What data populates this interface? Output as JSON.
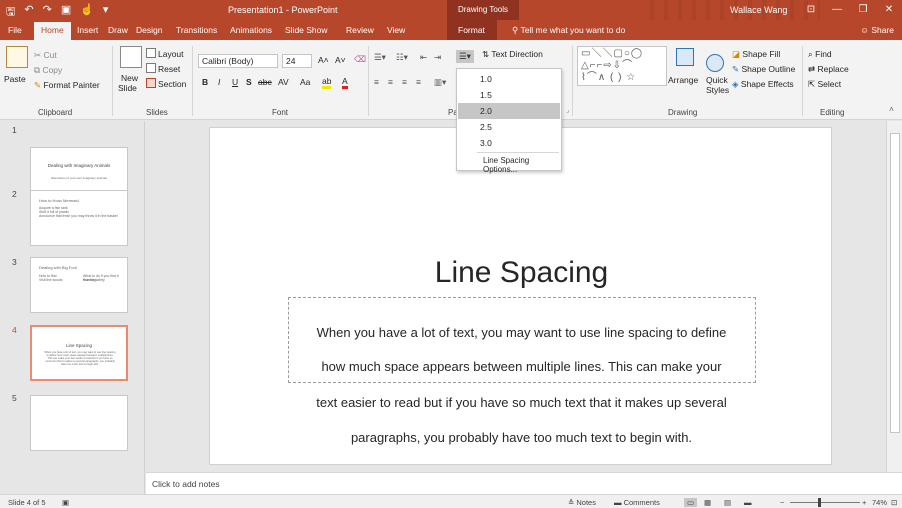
{
  "titlebar": {
    "title": "Presentation1 - PowerPoint",
    "context_label": "Drawing Tools",
    "user": "Wallace Wang",
    "qat": [
      "save-icon",
      "undo-icon",
      "redo-icon",
      "present-icon",
      "touch-icon",
      "customize-icon"
    ],
    "window_buttons": [
      "ribbon-display-icon",
      "minimize-icon",
      "restore-icon",
      "close-icon"
    ],
    "glyphs": {
      "save": "🖫",
      "undo": "↶",
      "redo": "↷",
      "present": "▣",
      "touch": "☝",
      "more": "▾",
      "ribbon": "⊡",
      "min": "—",
      "restore": "❐",
      "close": "✕"
    }
  },
  "tabs": {
    "items": [
      "File",
      "Home",
      "Insert",
      "Draw",
      "Design",
      "Transitions",
      "Animations",
      "Slide Show",
      "Review",
      "View",
      "Format"
    ],
    "active": "Home",
    "tell_me": "Tell me what you want to do",
    "share": "Share"
  },
  "ribbon": {
    "clipboard": {
      "paste": "Paste",
      "cut": "Cut",
      "copy": "Copy",
      "format_painter": "Format Painter",
      "label": "Clipboard"
    },
    "slides": {
      "new_slide": "New",
      "new_slide2": "Slide",
      "layout": "Layout",
      "reset": "Reset",
      "section": "Section",
      "label": "Slides"
    },
    "font": {
      "name": "Calibri (Body)",
      "size": "24",
      "label": "Font",
      "bold": "B",
      "italic": "I",
      "underline": "U",
      "shadow": "S",
      "strike": "abc",
      "spacing": "AV",
      "case": "Aa",
      "grow": "A˄",
      "shrink": "A˅"
    },
    "paragraph": {
      "label": "Pa",
      "text_direction": "Text Direction"
    },
    "drawing": {
      "arrange": "Arrange",
      "quick_styles": "Quick",
      "quick_styles2": "Styles",
      "shape_fill": "Shape Fill",
      "shape_outline": "Shape Outline",
      "shape_effects": "Shape Effects",
      "label": "Drawing",
      "shapes_row1": "▭＼＼▢○◯",
      "shapes_row2": "△⌐⌐⇨⇩⌒",
      "shapes_row3": "⌇⌒∧ ( ) ☆"
    },
    "editing": {
      "find": "Find",
      "replace": "Replace",
      "select": "Select",
      "label": "Editing"
    }
  },
  "line_spacing_menu": {
    "options": [
      "1.0",
      "1.5",
      "2.0",
      "2.5",
      "3.0"
    ],
    "selected": "2.0",
    "more": "Line Spacing Options..."
  },
  "thumbnails": [
    {
      "num": "1",
      "title": "Dealing with Imaginary Animals",
      "sub": "Discussion of your own imaginary animals"
    },
    {
      "num": "2",
      "title": "How to Hoax Mermaid",
      "bullets": [
        "Acquire a fish tank",
        "Stuff it full of plastic",
        "Announce that fresh you may throw it in the basket"
      ]
    },
    {
      "num": "3",
      "title": "Dealing with Big Foot",
      "col1": "How to find",
      "col2": "What to do if you find it roaming",
      "col1b": "Visit the woods",
      "col2b": "Run for safety"
    },
    {
      "num": "4",
      "title": "Line Spacing",
      "body": "When you have a lot of text, you may want to use line spacing to define how much space appears between multiple lines. This can make your text easier to read but if you have so much text that it makes up several paragraphs, you probably have too much text to begin with."
    },
    {
      "num": "5"
    }
  ],
  "slide": {
    "title": "Line Spacing",
    "lines": [
      "When you have a lot of text, you may want to use line spacing to define",
      "how much space appears between multiple lines. This can make your",
      "text easier to read but if you have so much text that it makes up several",
      "paragraphs, you probably have too much text to begin with."
    ]
  },
  "notes": {
    "placeholder": "Click to add notes"
  },
  "statusbar": {
    "slide_info": "Slide 4 of 5",
    "notes": "Notes",
    "comments": "Comments",
    "zoom": "74%",
    "zoom_minus": "−",
    "zoom_plus": "+"
  }
}
